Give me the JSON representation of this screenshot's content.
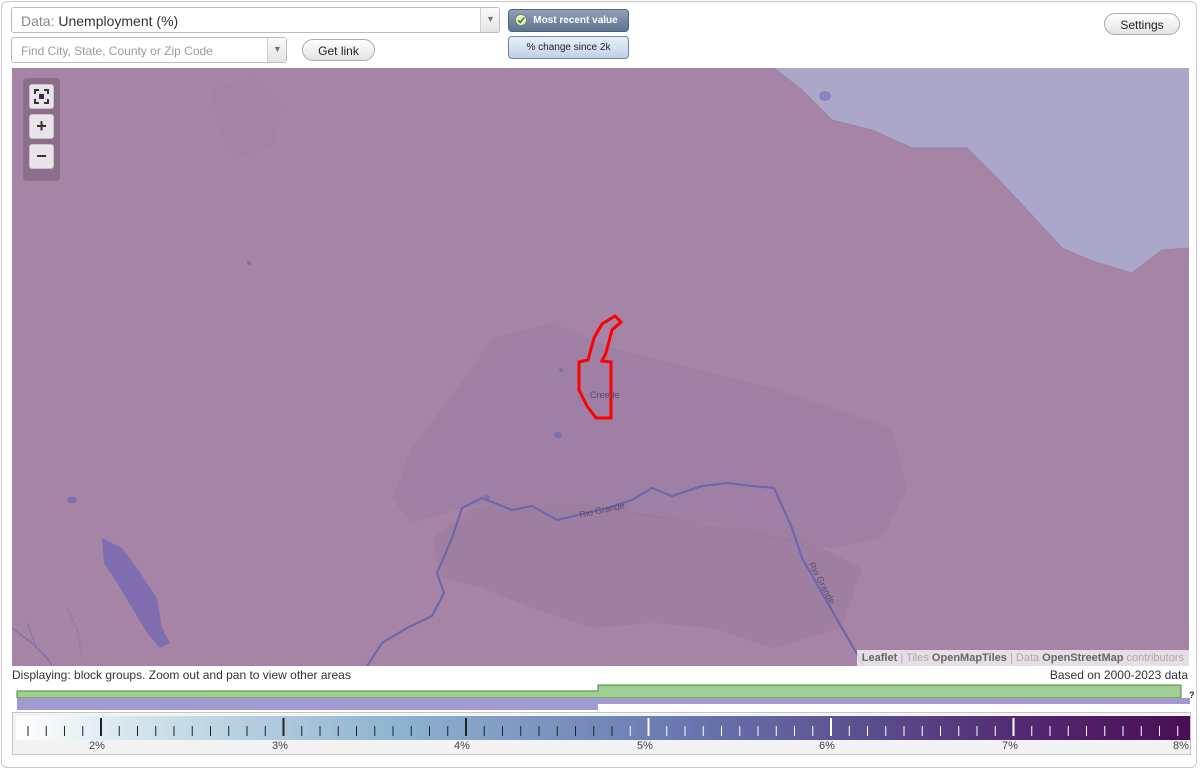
{
  "controls": {
    "data_prefix": "Data:",
    "data_value": "Unemployment (%)",
    "search_placeholder": "Find City, State, County or Zip Code",
    "get_link_label": "Get link",
    "settings_label": "Settings",
    "toggle_active_label": "Most recent value",
    "toggle_inactive_label": "% change since 2k",
    "dropdown_icon": "triangle-down-icon"
  },
  "map": {
    "zoom_controls": [
      "fit-icon",
      "+",
      "−"
    ],
    "labels": {
      "town": "Creede",
      "river_1": "Rio Grande",
      "river_2": "Rio Grande"
    },
    "attribution": {
      "leaflet": "Leaflet",
      "sep1": " | Tiles ",
      "tiles": "OpenMapTiles",
      "sep2": " | Data ",
      "data": "OpenStreetMap",
      "contributors": " contributors"
    },
    "colors": {
      "base_fill": "#a684a6",
      "light_region": "#aaa7c8",
      "water": "#7f6fb0",
      "selection_outline": "#ff0000"
    }
  },
  "status": {
    "displaying": "Displaying: block groups. Zoom out and pan to view other areas",
    "based_on": "Based on 2000-2023 data"
  },
  "histogram": {
    "help": "?"
  },
  "legend": {
    "labels": [
      "2%",
      "3%",
      "4%",
      "5%",
      "6%",
      "7%",
      "8%"
    ]
  }
}
